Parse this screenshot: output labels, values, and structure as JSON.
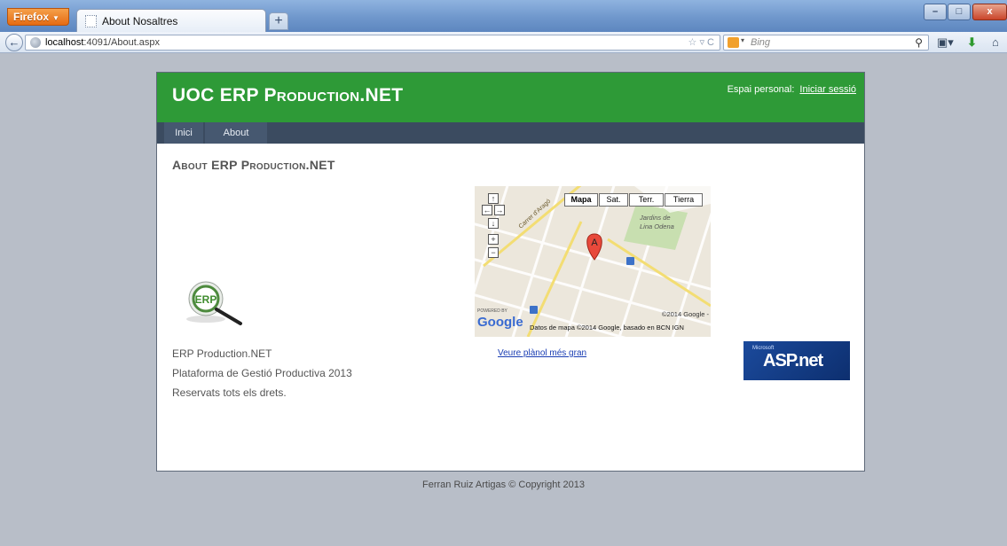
{
  "browser": {
    "menu_button": "Firefox",
    "tab_title": "About Nosaltres",
    "new_tab": "+",
    "url_host": "localhost",
    "url_rest": ":4091/About.aspx",
    "search_placeholder": "Bing",
    "window_controls": {
      "minimize": "–",
      "maximize": "□",
      "close": "x"
    }
  },
  "header": {
    "title": "UOC ERP Production.NET",
    "login_prefix": "Espai personal:",
    "login_link": "Iniciar sessió"
  },
  "menu": {
    "items": [
      {
        "label": "Inici"
      },
      {
        "label": "About"
      }
    ]
  },
  "main": {
    "heading": "About ERP Production.NET",
    "info_lines": [
      "ERP Production.NET",
      "Plataforma de Gestió Productiva 2013",
      "Reservats tots els drets."
    ],
    "map": {
      "type_buttons": [
        "Mapa",
        "Sat.",
        "Terr.",
        "Tierra"
      ],
      "street_label": "Carrer d'Aragó",
      "place_label_1": "Jardins de",
      "place_label_2": "Lina Odena",
      "marker": "A",
      "powered_by": "POWERED BY",
      "google": "Google",
      "copyright": "©2014 Google -",
      "attribution": "Datos de mapa ©2014 Google, basado en BCN IGN"
    },
    "map_link": "Veure plànol més gran",
    "aspnet_small": "Microsoft",
    "aspnet_logo": "ASP.net"
  },
  "footer": {
    "text": "Ferran Ruiz Artigas © Copyright 2013"
  },
  "colors": {
    "header_green": "#2e9a37",
    "menu_dark": "#3b4b60",
    "background": "#b8bec8"
  }
}
